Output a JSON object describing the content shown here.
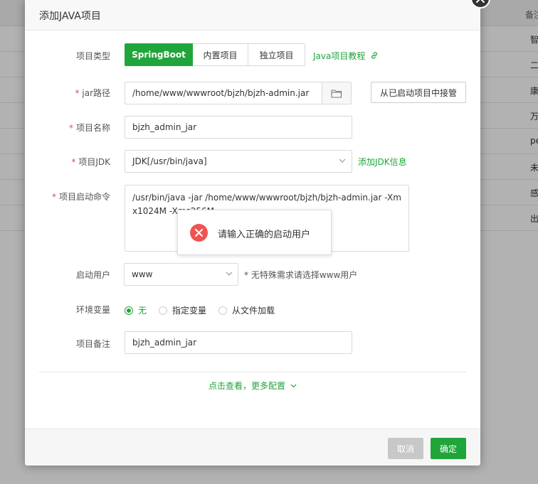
{
  "background": {
    "header_text": "备注",
    "rows": [
      "智",
      "二",
      "康",
      "万",
      "pe",
      "未",
      "感",
      "出"
    ]
  },
  "dialog": {
    "title": "添加JAVA项目",
    "project_type": {
      "label": "项目类型",
      "options": [
        "SpringBoot",
        "内置项目",
        "独立项目"
      ],
      "selected": "SpringBoot",
      "tutorial_link": "Java项目教程"
    },
    "jar_path": {
      "required": "*",
      "label": "jar路径",
      "value": "/home/www/wwwroot/bjzh/bjzh-admin.jar",
      "takeover_button": "从已启动项目中接管"
    },
    "project_name": {
      "required": "*",
      "label": "项目名称",
      "value": "bjzh_admin_jar"
    },
    "project_jdk": {
      "required": "*",
      "label": "项目JDK",
      "value": "JDK[/usr/bin/java]",
      "add_link": "添加JDK信息"
    },
    "start_command": {
      "required": "*",
      "label": "项目启动命令",
      "value": "/usr/bin/java -jar /home/www/wwwroot/bjzh/bjzh-admin.jar -Xmx1024M -Xms256M"
    },
    "start_user": {
      "label": "启动用户",
      "value": "www",
      "hint": "* 无特殊需求请选择www用户"
    },
    "env_vars": {
      "label": "环境变量",
      "options": [
        "无",
        "指定变量",
        "从文件加载"
      ],
      "selected": "无"
    },
    "remark": {
      "label": "项目备注",
      "value": "bjzh_admin_jar"
    },
    "more_config": "点击查看，更多配置",
    "cancel_button": "取消",
    "confirm_button": "确定"
  },
  "toast": {
    "message": "请输入正确的启动用户"
  },
  "colors": {
    "accent": "#20a53a",
    "required": "#e14d4d",
    "error": "#ef5350",
    "cancel_disabled": "#c8c8c8"
  }
}
